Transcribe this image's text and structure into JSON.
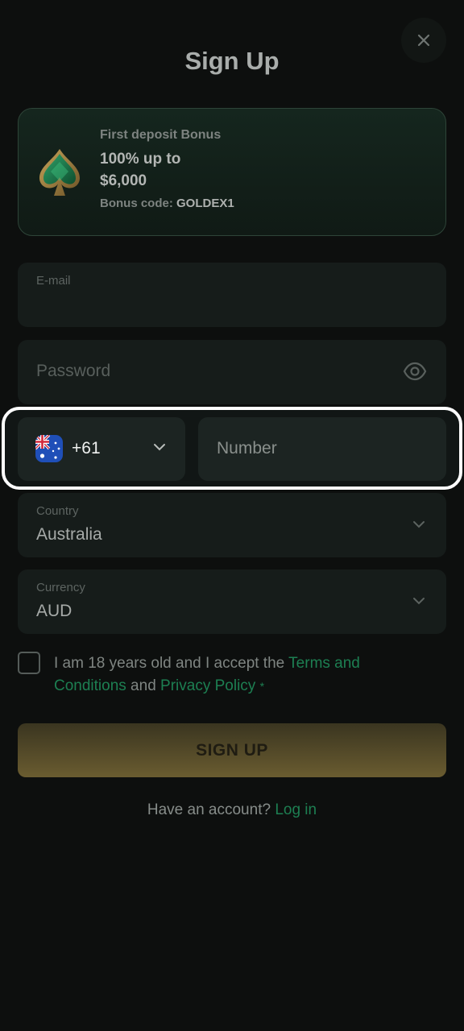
{
  "header": {
    "title": "Sign Up"
  },
  "bonus": {
    "subtitle": "First deposit Bonus",
    "amount": "100% up to $6,000",
    "code_label": "Bonus code:",
    "code": "GOLDEX1"
  },
  "form": {
    "email_label": "E-mail",
    "password_placeholder": "Password",
    "phone_code": "+61",
    "phone_placeholder": "Number",
    "country_label": "Country",
    "country_value": "Australia",
    "currency_label": "Currency",
    "currency_value": "AUD"
  },
  "terms": {
    "prefix": "I am 18 years old and I accept the ",
    "terms_link": "Terms and Conditions",
    "and": " and ",
    "privacy_link": "Privacy Policy",
    "required_mark": "*"
  },
  "actions": {
    "signup_label": "SIGN UP",
    "have_account": "Have an account? ",
    "login_link": "Log in"
  },
  "icons": {
    "close": "close-icon",
    "bonus": "spade-icon",
    "eye": "eye-icon",
    "chevron": "chevron-down-icon",
    "flag": "australia-flag-icon"
  },
  "colors": {
    "background": "#0d0f0e",
    "accent_green": "#1d7f52",
    "button_gold": "#6a5c30",
    "highlight_border": "#ffffff"
  }
}
